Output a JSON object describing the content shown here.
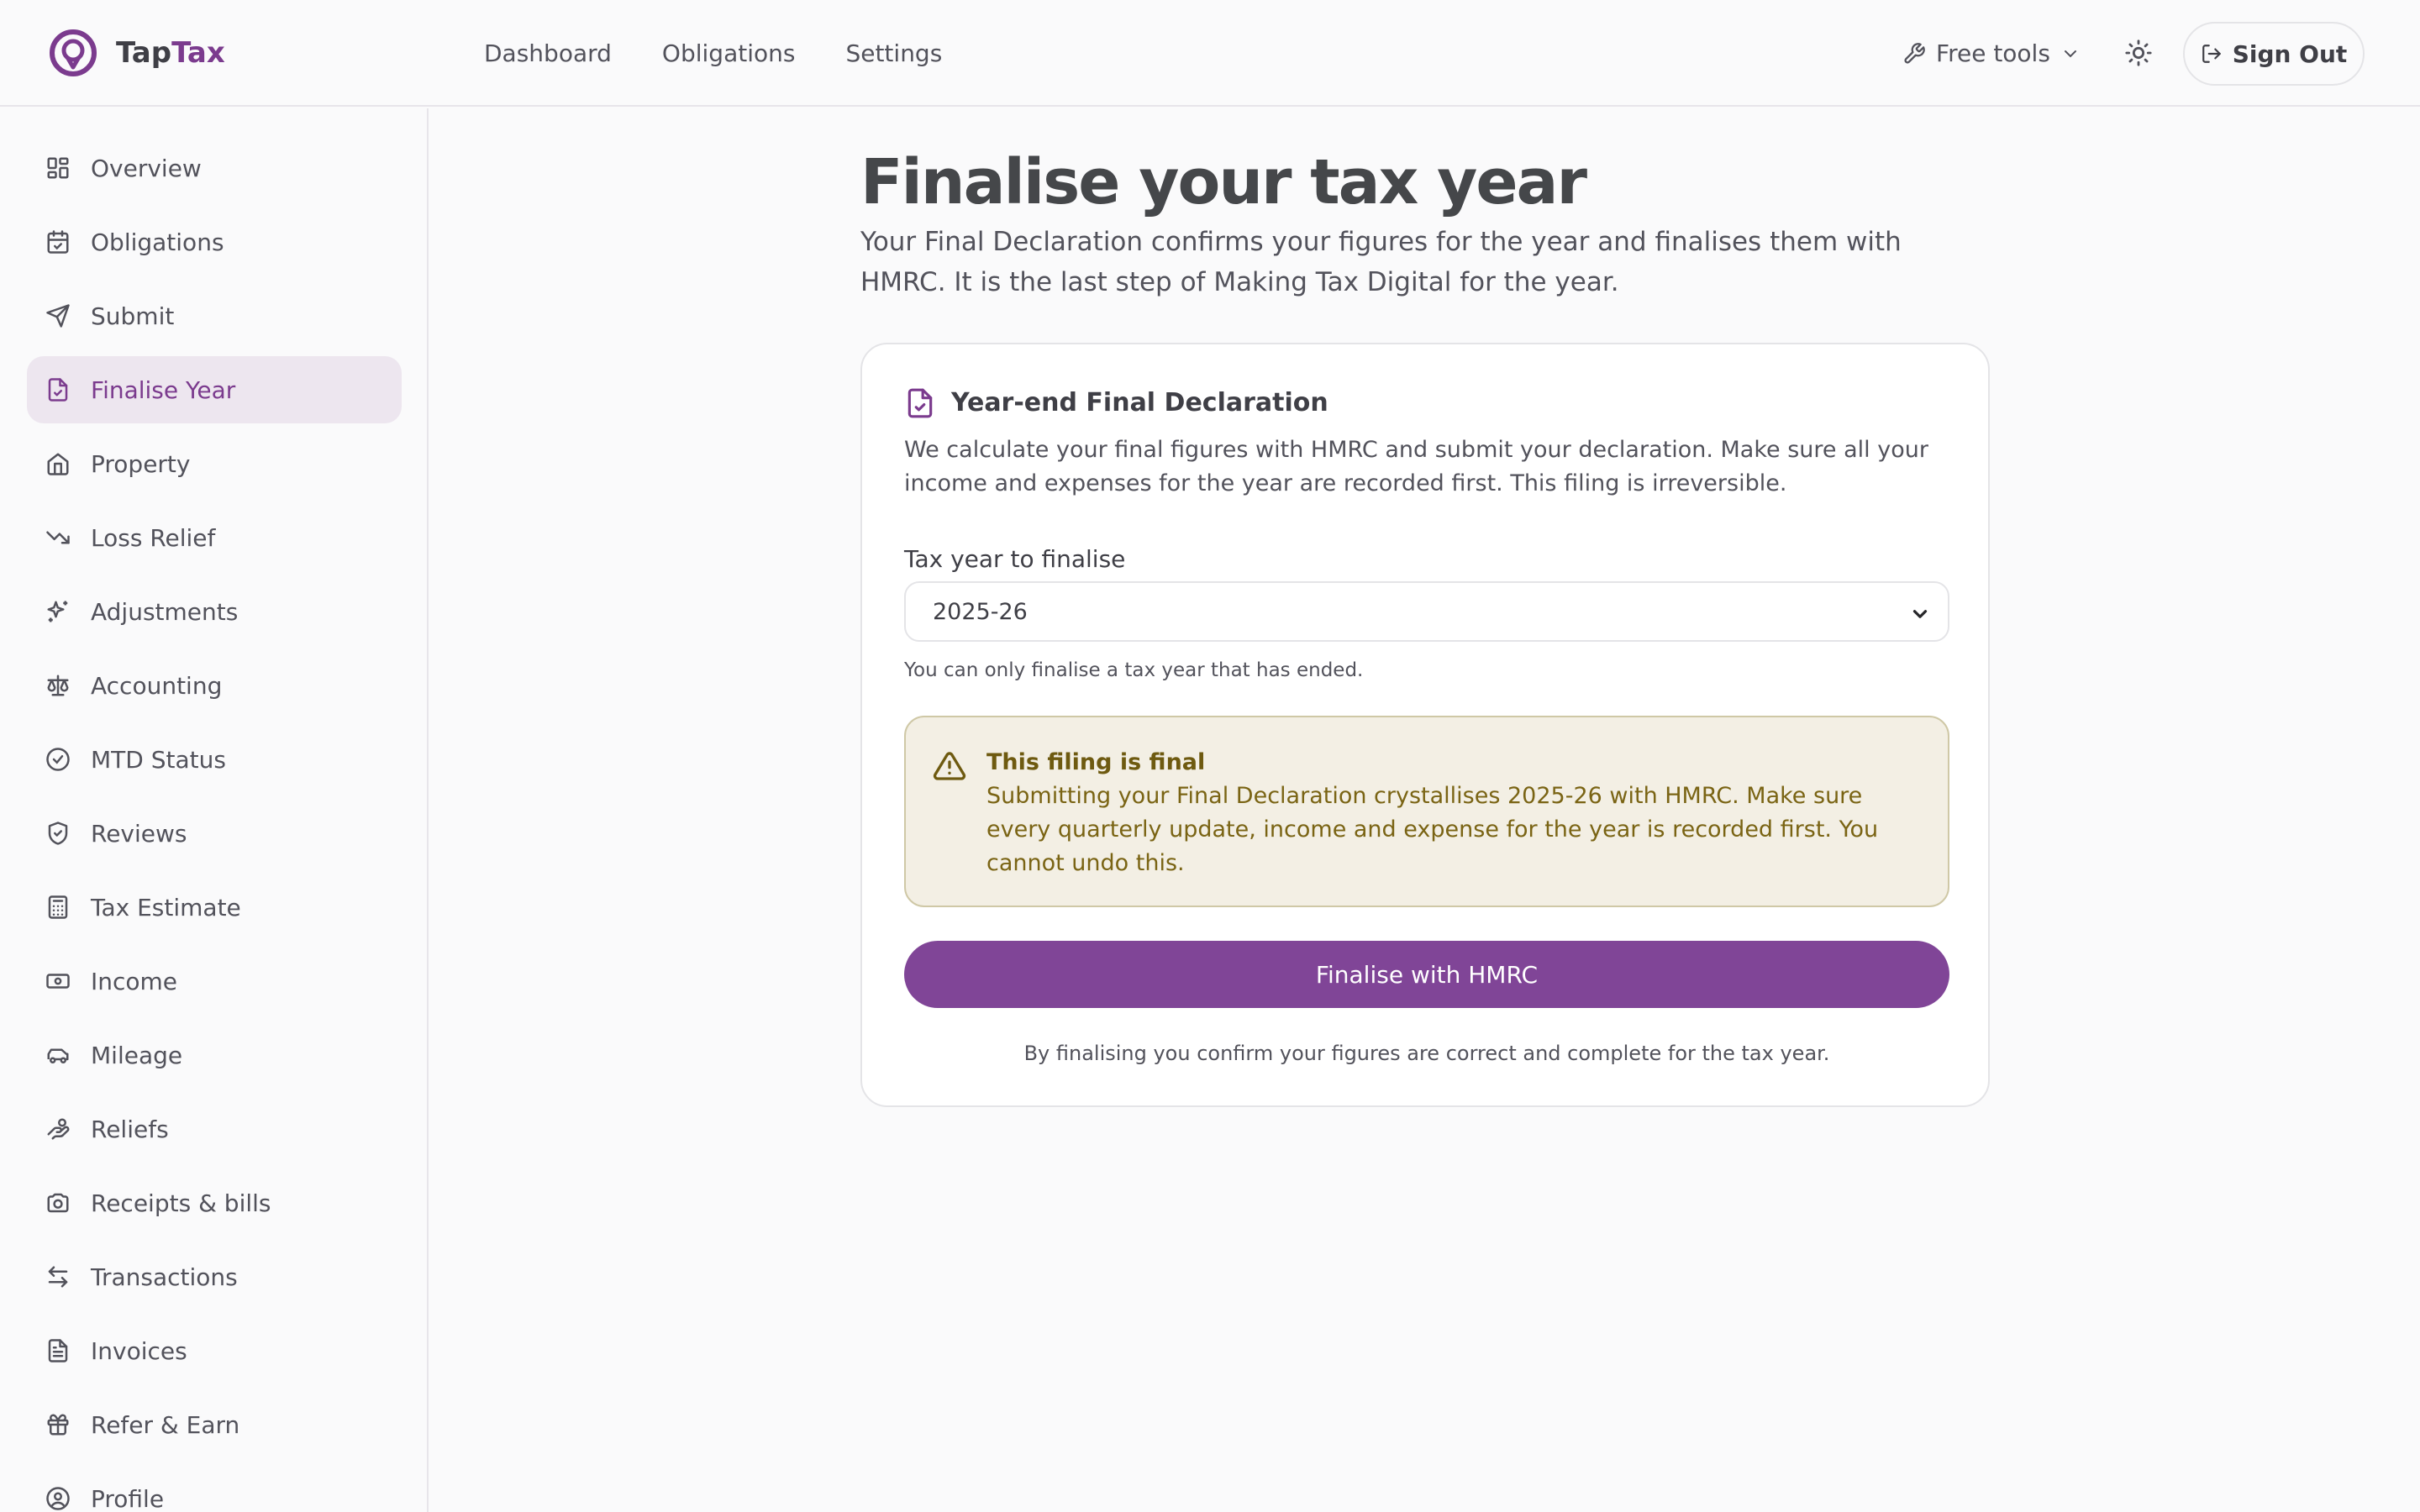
{
  "brand": {
    "part1": "Tap",
    "part2": "Tax"
  },
  "topnav": [
    {
      "label": "Dashboard"
    },
    {
      "label": "Obligations"
    },
    {
      "label": "Settings"
    }
  ],
  "header": {
    "free_tools": "Free tools",
    "sign_out": "Sign Out"
  },
  "sidebar": {
    "items": [
      {
        "label": "Overview",
        "icon": "grid-icon"
      },
      {
        "label": "Obligations",
        "icon": "calendar-check-icon"
      },
      {
        "label": "Submit",
        "icon": "send-icon"
      },
      {
        "label": "Finalise Year",
        "icon": "file-check-icon",
        "active": true
      },
      {
        "label": "Property",
        "icon": "home-icon"
      },
      {
        "label": "Loss Relief",
        "icon": "trending-down-icon"
      },
      {
        "label": "Adjustments",
        "icon": "sparkles-icon"
      },
      {
        "label": "Accounting",
        "icon": "scale-icon"
      },
      {
        "label": "MTD Status",
        "icon": "circle-check-icon"
      },
      {
        "label": "Reviews",
        "icon": "shield-check-icon"
      },
      {
        "label": "Tax Estimate",
        "icon": "calculator-icon"
      },
      {
        "label": "Income",
        "icon": "banknote-icon"
      },
      {
        "label": "Mileage",
        "icon": "car-icon"
      },
      {
        "label": "Reliefs",
        "icon": "hand-coins-icon"
      },
      {
        "label": "Receipts & bills",
        "icon": "camera-icon"
      },
      {
        "label": "Transactions",
        "icon": "arrows-left-right-icon"
      },
      {
        "label": "Invoices",
        "icon": "file-text-icon"
      },
      {
        "label": "Refer & Earn",
        "icon": "gift-icon"
      },
      {
        "label": "Profile",
        "icon": "user-circle-icon"
      }
    ]
  },
  "main": {
    "title": "Finalise your tax year",
    "lead": "Your Final Declaration confirms your figures for the year and finalises them with HMRC. It is the last step of Making Tax Digital for the year.",
    "card": {
      "title": "Year-end Final Declaration",
      "description": "We calculate your final figures with HMRC and submit your declaration. Make sure all your income and expenses for the year are recorded first. This filing is irreversible.",
      "field_label": "Tax year to finalise",
      "selected_year": "2025-26",
      "hint": "You can only finalise a tax year that has ended.",
      "warning_title": "This filing is final",
      "warning_body": "Submitting your Final Declaration crystallises 2025-26 with HMRC. Make sure every quarterly update, income and expense for the year is recorded first. You cannot undo this.",
      "button": "Finalise with HMRC",
      "footnote": "By finalising you confirm your figures are correct and complete for the tax year."
    }
  },
  "colors": {
    "accent": "#804597",
    "accent_text": "#7b3b8e",
    "active_bg": "#ede6ef",
    "warning_bg": "#f3efe4",
    "warning_text": "#7a6414"
  }
}
